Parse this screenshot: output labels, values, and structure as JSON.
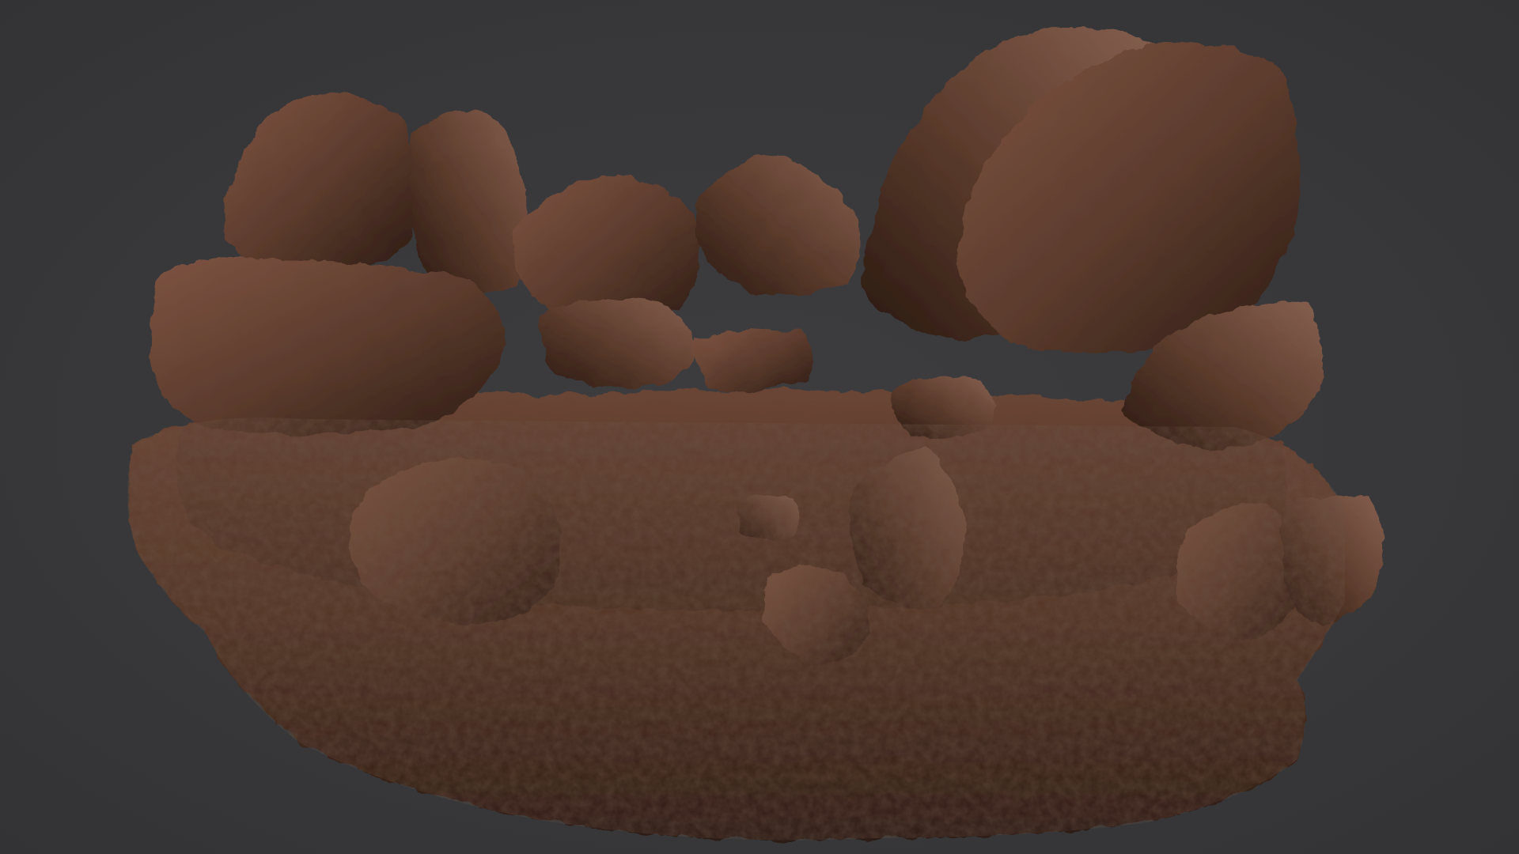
{
  "viewport": {
    "background_color": "#3a3a3c",
    "subject": "rock-terrain-sculpt",
    "material_colors": {
      "base": "#5a3a2c",
      "highlight": "#8a5e48",
      "shadow": "#24160f",
      "mid": "#6b4533"
    }
  }
}
